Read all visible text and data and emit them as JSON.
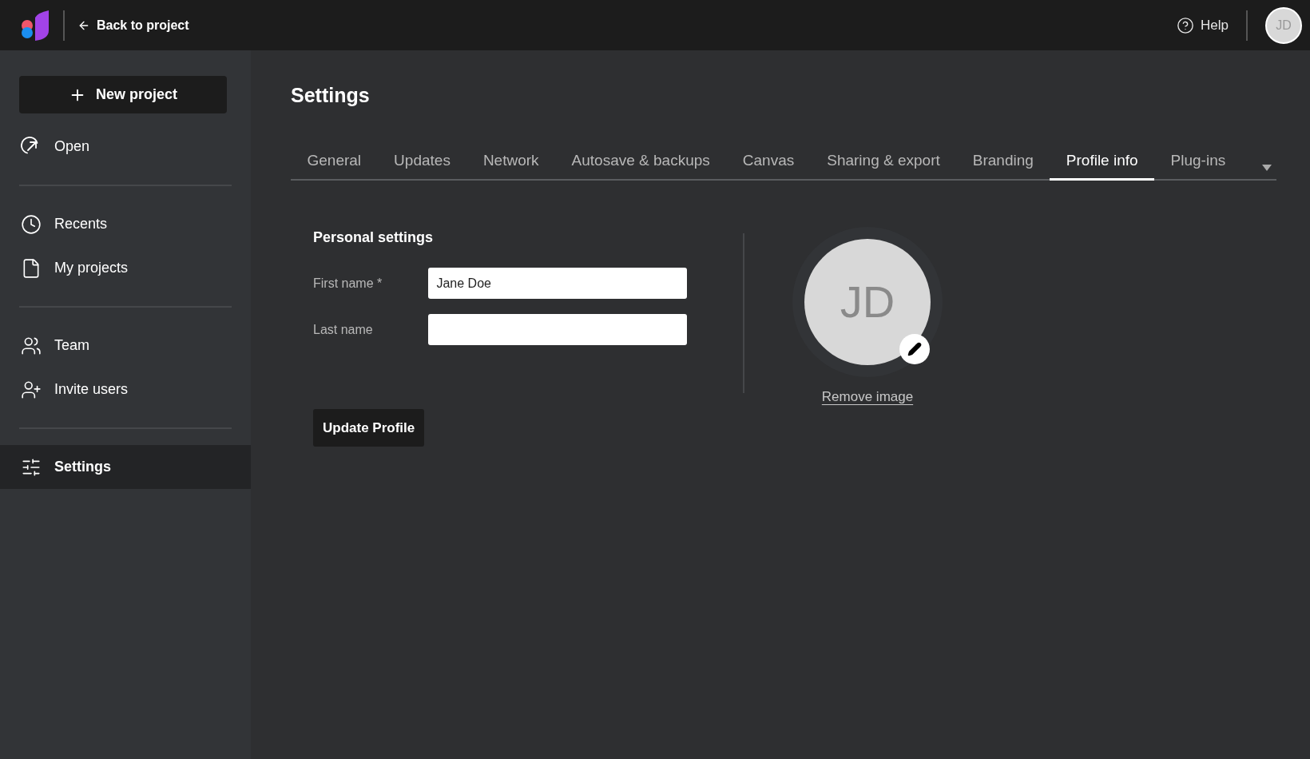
{
  "top_bar": {
    "back_link": "Back to project",
    "help": "Help",
    "avatar_initials": "JD"
  },
  "sidebar": {
    "new_project": "New project",
    "groups": [
      [
        {
          "kind": "open",
          "label": "Open",
          "selected": false
        }
      ],
      [
        {
          "kind": "recents",
          "label": "Recents",
          "selected": false
        },
        {
          "kind": "projects",
          "label": "My projects",
          "selected": false
        }
      ],
      [
        {
          "kind": "team",
          "label": "Team",
          "selected": false
        },
        {
          "kind": "invite",
          "label": "Invite users",
          "selected": false
        }
      ],
      [
        {
          "kind": "settings",
          "label": "Settings",
          "selected": true
        }
      ]
    ]
  },
  "page_title": "Settings",
  "tabs": [
    {
      "label": "General",
      "selected": false
    },
    {
      "label": "Updates",
      "selected": false
    },
    {
      "label": "Network",
      "selected": false
    },
    {
      "label": "Autosave & backups",
      "selected": false
    },
    {
      "label": "Canvas",
      "selected": false
    },
    {
      "label": "Sharing & export",
      "selected": false
    },
    {
      "label": "Branding",
      "selected": false
    },
    {
      "label": "Profile info",
      "selected": true
    },
    {
      "label": "Plug-ins",
      "selected": false
    }
  ],
  "form": {
    "title": "Personal settings",
    "fields": [
      {
        "label": "First name *",
        "value": "Jane Doe"
      },
      {
        "label": "Last name"
      }
    ],
    "submit": "Update Profile"
  },
  "avatar": {
    "initials": "JD",
    "remove_link": "Remove image"
  }
}
